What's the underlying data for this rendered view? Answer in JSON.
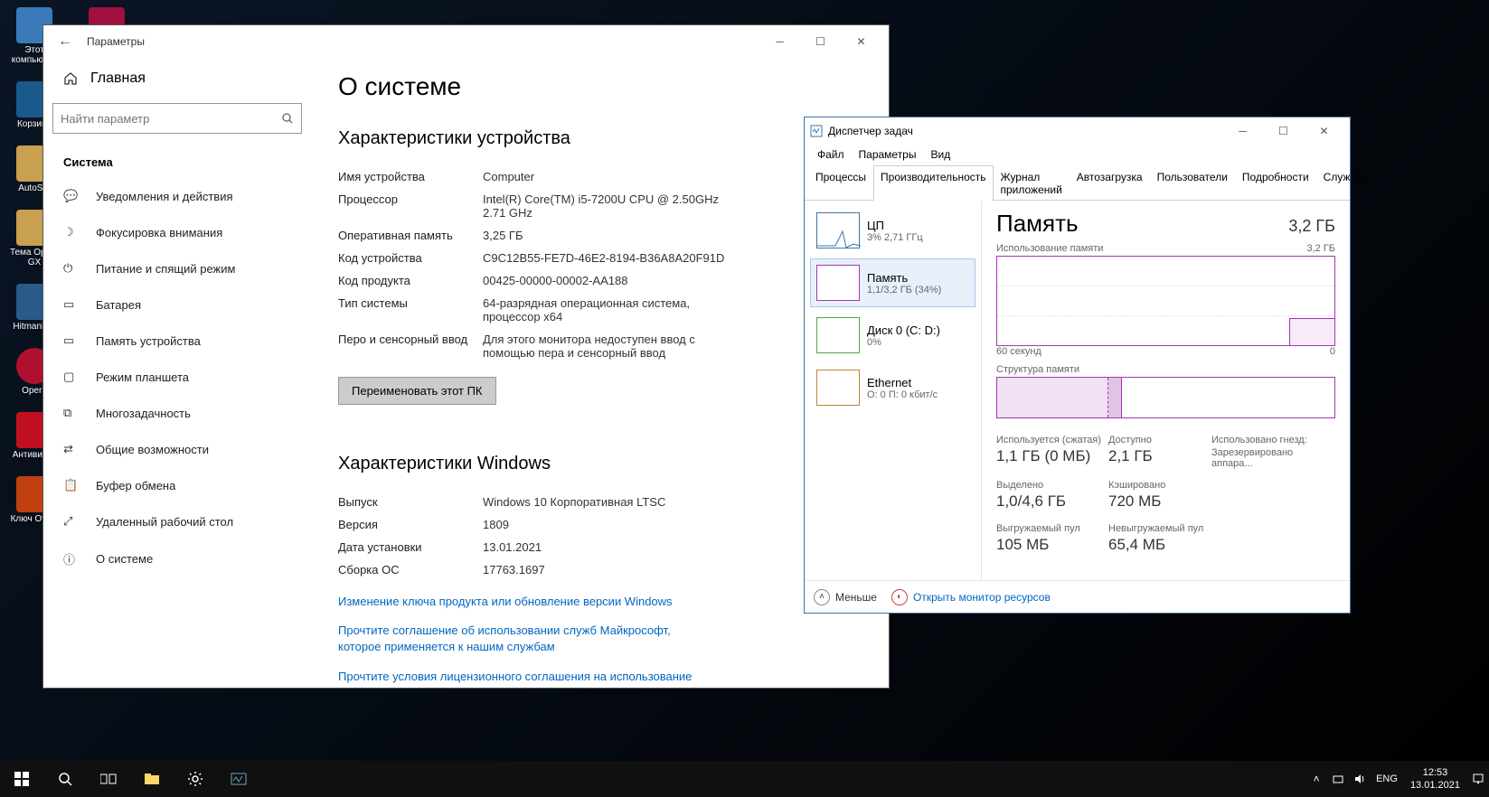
{
  "desktop": {
    "icons": [
      "Этот компьютер",
      "Корзина",
      "AutoSet",
      "Тема Opera GX",
      "HitmanPro",
      "Opera",
      "Антивирус",
      "Ключ Office"
    ]
  },
  "settings": {
    "window_title": "Параметры",
    "home": "Главная",
    "search_placeholder": "Найти параметр",
    "category": "Система",
    "nav": [
      "Уведомления и действия",
      "Фокусировка внимания",
      "Питание и спящий режим",
      "Батарея",
      "Память устройства",
      "Режим планшета",
      "Многозадачность",
      "Общие возможности",
      "Буфер обмена",
      "Удаленный рабочий стол",
      "О системе"
    ],
    "page_title": "О системе",
    "device_specs_title": "Характеристики устройства",
    "device_specs": [
      {
        "label": "Имя устройства",
        "value": "Computer"
      },
      {
        "label": "Процессор",
        "value": "Intel(R) Core(TM) i5-7200U CPU @ 2.50GHz 2.71 GHz"
      },
      {
        "label": "Оперативная память",
        "value": "3,25 ГБ"
      },
      {
        "label": "Код устройства",
        "value": "C9C12B55-FE7D-46E2-8194-B36A8A20F91D"
      },
      {
        "label": "Код продукта",
        "value": "00425-00000-00002-AA188"
      },
      {
        "label": "Тип системы",
        "value": "64-разрядная операционная система, процессор x64"
      },
      {
        "label": "Перо и сенсорный ввод",
        "value": "Для этого монитора недоступен ввод с помощью пера и сенсорный ввод"
      }
    ],
    "rename_button": "Переименовать этот ПК",
    "windows_specs_title": "Характеристики Windows",
    "windows_specs": [
      {
        "label": "Выпуск",
        "value": "Windows 10 Корпоративная LTSC"
      },
      {
        "label": "Версия",
        "value": "1809"
      },
      {
        "label": "Дата установки",
        "value": "13.01.2021"
      },
      {
        "label": "Сборка ОС",
        "value": "17763.1697"
      }
    ],
    "links": [
      "Изменение ключа продукта или обновление версии Windows",
      "Прочтите соглашение об использовании служб Майкрософт, которое применяется к нашим службам",
      "Прочтите условия лицензионного соглашения на использование программного обеспечения корпорации Майкрософт"
    ]
  },
  "taskmgr": {
    "title": "Диспетчер задач",
    "menu": [
      "Файл",
      "Параметры",
      "Вид"
    ],
    "tabs": [
      "Процессы",
      "Производительность",
      "Журнал приложений",
      "Автозагрузка",
      "Пользователи",
      "Подробности",
      "Службы"
    ],
    "side": [
      {
        "title": "ЦП",
        "sub": "3% 2,71 ГГц"
      },
      {
        "title": "Память",
        "sub": "1,1/3,2 ГБ (34%)"
      },
      {
        "title": "Диск 0 (C: D:)",
        "sub": "0%"
      },
      {
        "title": "Ethernet",
        "sub": "О: 0 П: 0 кбит/с"
      }
    ],
    "main_title": "Память",
    "main_total": "3,2 ГБ",
    "usage_label": "Использование памяти",
    "usage_max": "3,2 ГБ",
    "axis_left": "60 секунд",
    "axis_right": "0",
    "struct_label": "Структура памяти",
    "stats": {
      "used_label": "Используется (сжатая)",
      "used_value": "1,1 ГБ (0 МБ)",
      "avail_label": "Доступно",
      "avail_value": "2,1 ГБ",
      "hw_label": "Использовано гнезд:",
      "hw_value": "Зарезервировано аппара...",
      "commit_label": "Выделено",
      "commit_value": "1,0/4,6 ГБ",
      "cached_label": "Кэшировано",
      "cached_value": "720 МБ",
      "paged_label": "Выгружаемый пул",
      "paged_value": "105 МБ",
      "nonpaged_label": "Невыгружаемый пул",
      "nonpaged_value": "65,4 МБ"
    },
    "fewer": "Меньше",
    "open_monitor": "Открыть монитор ресурсов"
  },
  "taskbar": {
    "lang": "ENG",
    "time": "12:53",
    "date": "13.01.2021"
  }
}
